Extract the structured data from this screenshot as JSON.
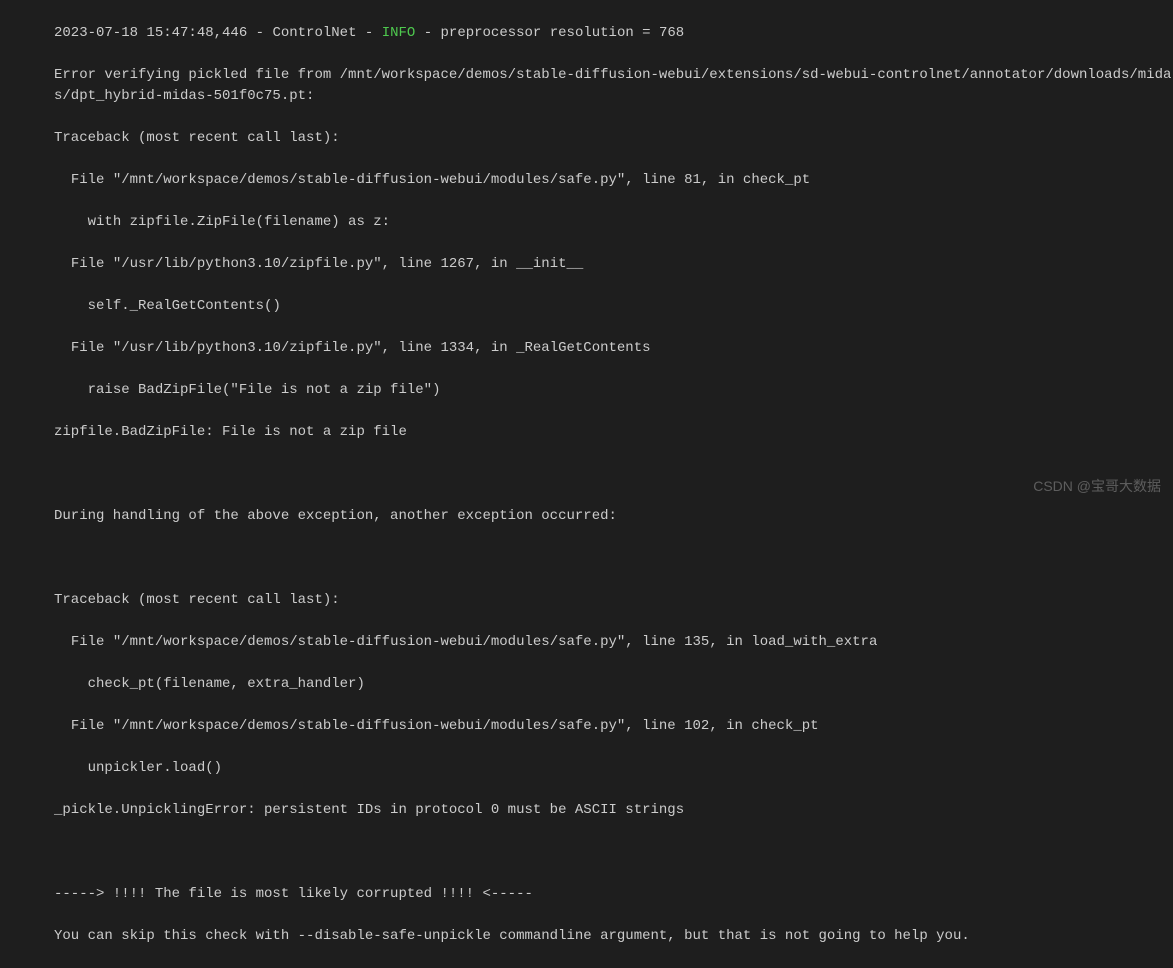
{
  "log": {
    "timestamp": "2023-07-18 15:47:48,446",
    "sep1": " - ",
    "logger": "ControlNet",
    "sep2": " - ",
    "level": "INFO",
    "sep3": " - ",
    "message": "preprocessor resolution = 768"
  },
  "lines": {
    "l1": "Error verifying pickled file from /mnt/workspace/demos/stable-diffusion-webui/extensions/sd-webui-controlnet/annotator/downloads/midas/dpt_hybrid-midas-501f0c75.pt:",
    "l2": "Traceback (most recent call last):",
    "l3": "  File \"/mnt/workspace/demos/stable-diffusion-webui/modules/safe.py\", line 81, in check_pt",
    "l4": "    with zipfile.ZipFile(filename) as z:",
    "l5": "  File \"/usr/lib/python3.10/zipfile.py\", line 1267, in __init__",
    "l6": "    self._RealGetContents()",
    "l7": "  File \"/usr/lib/python3.10/zipfile.py\", line 1334, in _RealGetContents",
    "l8": "    raise BadZipFile(\"File is not a zip file\")",
    "l9": "zipfile.BadZipFile: File is not a zip file",
    "l10": "",
    "l11": "During handling of the above exception, another exception occurred:",
    "l12": "",
    "l13": "Traceback (most recent call last):",
    "l14": "  File \"/mnt/workspace/demos/stable-diffusion-webui/modules/safe.py\", line 135, in load_with_extra",
    "l15": "    check_pt(filename, extra_handler)",
    "l16": "  File \"/mnt/workspace/demos/stable-diffusion-webui/modules/safe.py\", line 102, in check_pt",
    "l17": "    unpickler.load()",
    "l18": "_pickle.UnpicklingError: persistent IDs in protocol 0 must be ASCII strings",
    "l19": "",
    "l20": "-----> !!!! The file is most likely corrupted !!!! <-----",
    "l21": "You can skip this check with --disable-safe-unpickle commandline argument, but that is not going to help you."
  },
  "watermark": "CSDN @宝哥大数据"
}
